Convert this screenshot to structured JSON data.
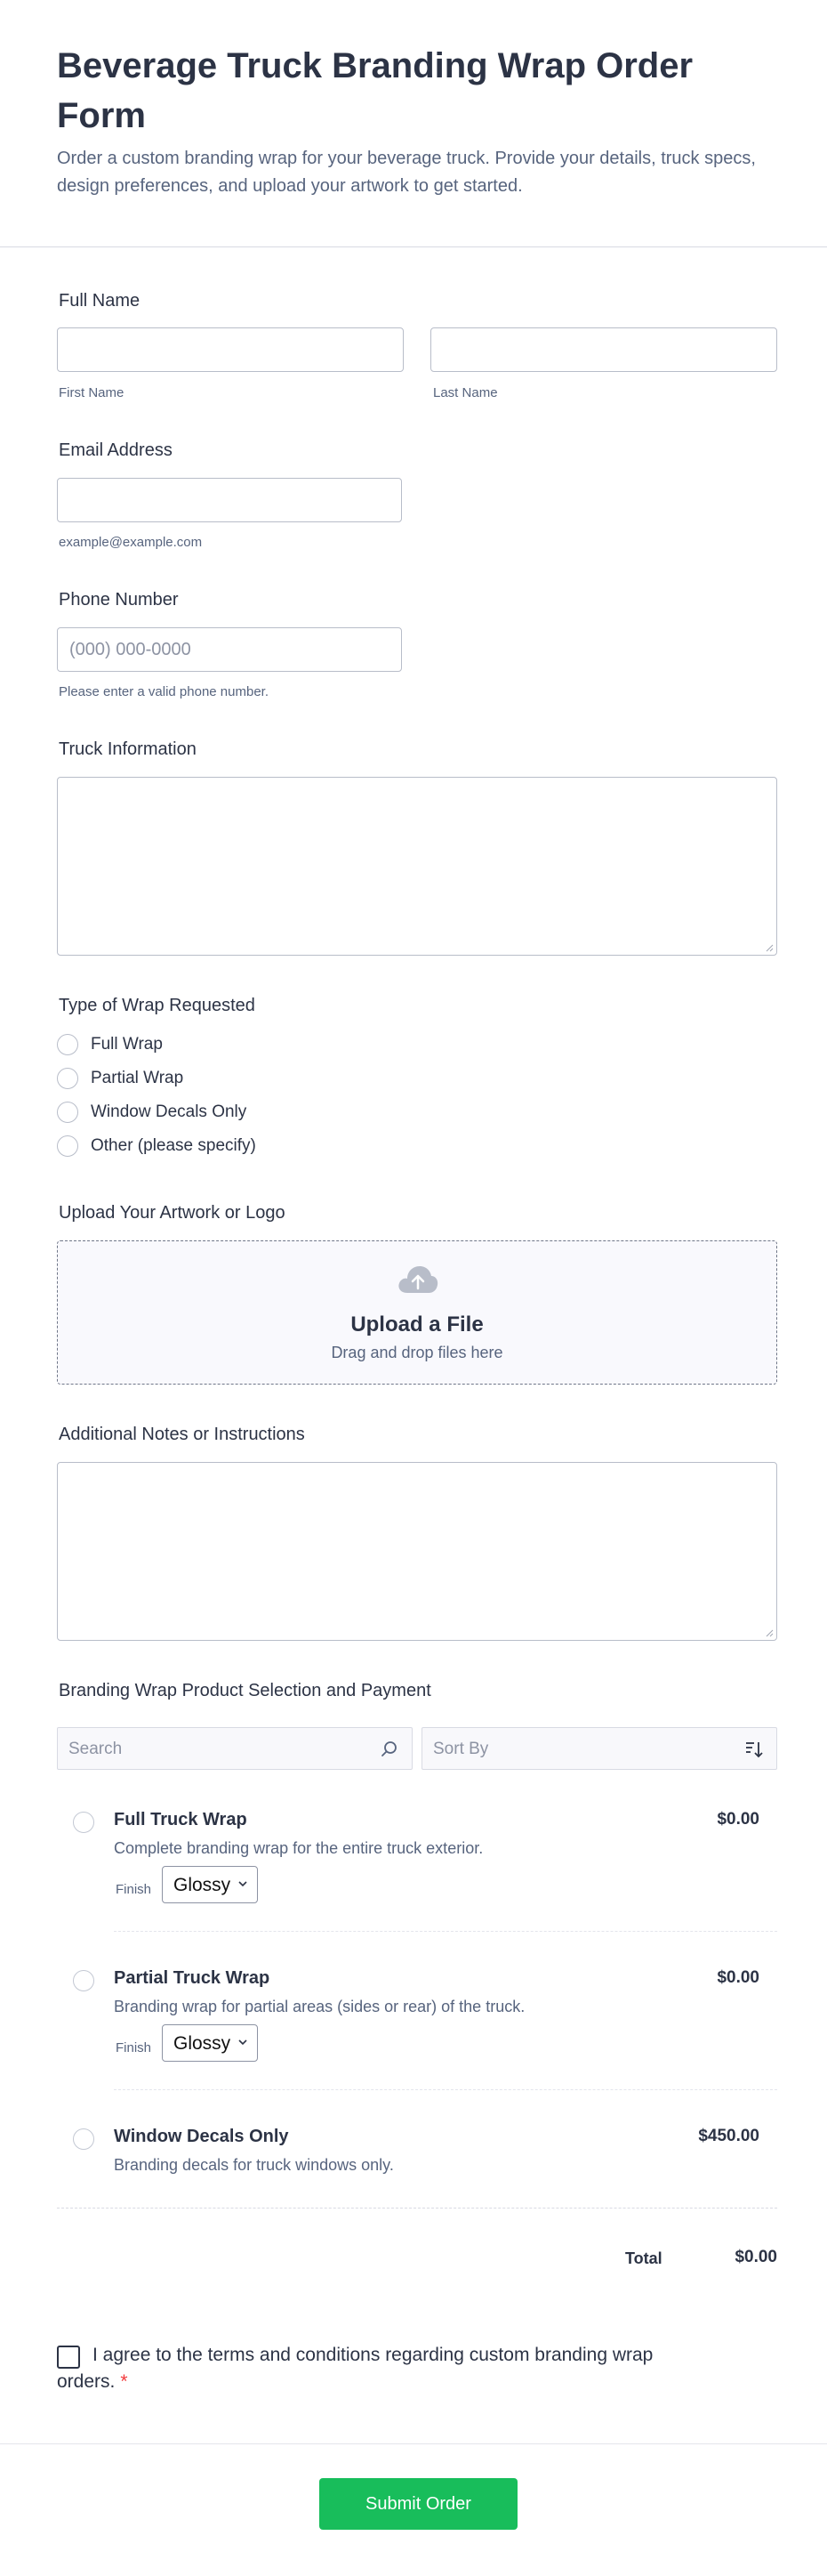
{
  "header": {
    "title": "Beverage Truck Branding Wrap Order Form",
    "subtitle": "Order a custom branding wrap for your beverage truck. Provide your details, truck specs, design preferences, and upload your artwork to get started."
  },
  "full_name": {
    "label": "Full Name",
    "first_sublabel": "First Name",
    "last_sublabel": "Last Name"
  },
  "email": {
    "label": "Email Address",
    "sublabel": "example@example.com"
  },
  "phone": {
    "label": "Phone Number",
    "placeholder": "(000) 000-0000",
    "sublabel": "Please enter a valid phone number."
  },
  "truck_info": {
    "label": "Truck Information"
  },
  "wrap_type": {
    "label": "Type of Wrap Requested",
    "options": [
      "Full Wrap",
      "Partial Wrap",
      "Window Decals Only",
      "Other (please specify)"
    ]
  },
  "upload": {
    "label": "Upload Your Artwork or Logo",
    "title": "Upload a File",
    "subtitle": "Drag and drop files here"
  },
  "notes": {
    "label": "Additional Notes or Instructions"
  },
  "products": {
    "label": "Branding Wrap Product Selection and Payment",
    "search_placeholder": "Search",
    "sort_placeholder": "Sort By",
    "finish_label": "Finish",
    "items": [
      {
        "name": "Full Truck Wrap",
        "description": "Complete branding wrap for the entire truck exterior.",
        "price": "$0.00",
        "finish": "Glossy"
      },
      {
        "name": "Partial Truck Wrap",
        "description": "Branding wrap for partial areas (sides or rear) of the truck.",
        "price": "$0.00",
        "finish": "Glossy"
      },
      {
        "name": "Window Decals Only",
        "description": "Branding decals for truck windows only.",
        "price": "$450.00"
      }
    ],
    "total_label": "Total",
    "total_value": "$0.00"
  },
  "terms": {
    "text": "I agree to the terms and conditions regarding custom branding wrap orders.",
    "required_mark": "*"
  },
  "submit": {
    "label": "Submit Order"
  },
  "colors": {
    "text": "#2c3345",
    "muted": "#57647e",
    "submit": "#18bd5b",
    "required": "#f23a3c"
  }
}
